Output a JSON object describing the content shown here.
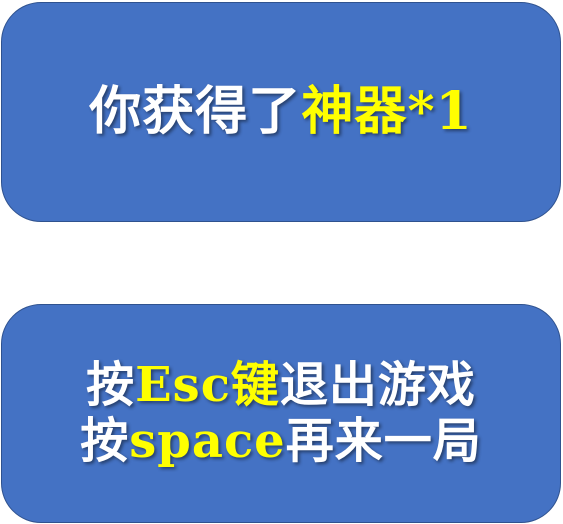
{
  "reward": {
    "prefix": "你获得了",
    "item": "神器*1"
  },
  "controls": {
    "line1": {
      "prefix": "按",
      "key": "Esc键",
      "action": "退出游戏"
    },
    "line2": {
      "prefix": "按",
      "key": "space",
      "action": "再来一局"
    }
  },
  "colors": {
    "panel": "#4472c4",
    "panel_border": "#2f528f",
    "text": "#ffffff",
    "highlight": "#ffff00"
  }
}
